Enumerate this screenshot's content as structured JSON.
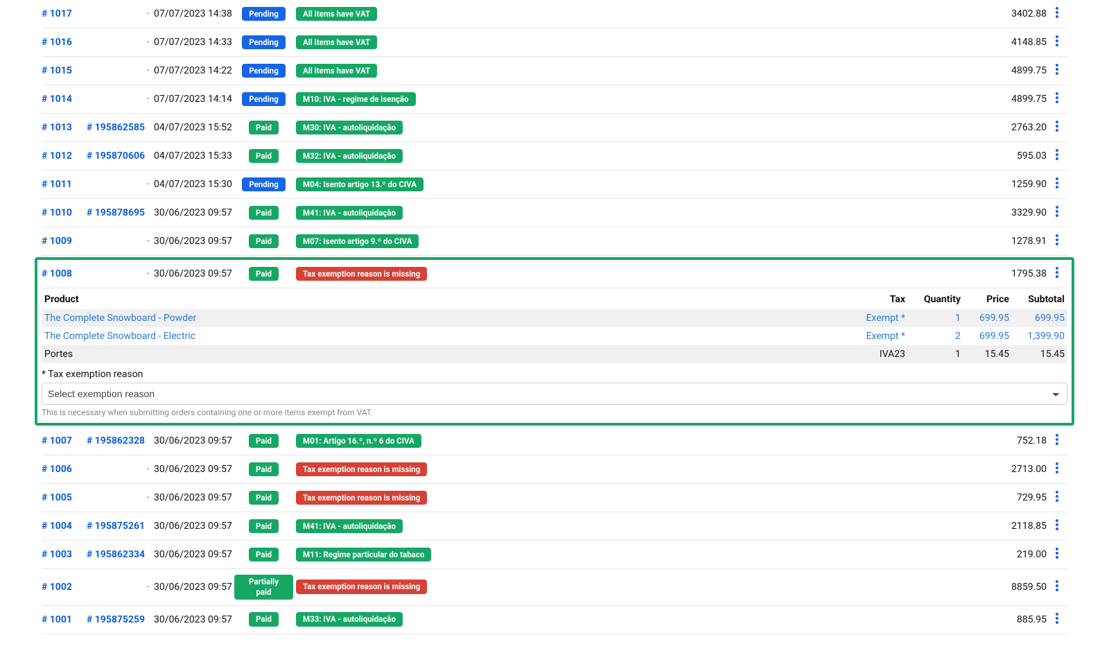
{
  "rows": [
    {
      "id": "# 1017",
      "ref": "",
      "date": "07/07/2023 14:38",
      "status": "Pending",
      "status_cls": "b-pending",
      "tag": "All items have VAT",
      "tag_cls": "b-green",
      "amount": "3402.88"
    },
    {
      "id": "# 1016",
      "ref": "",
      "date": "07/07/2023 14:33",
      "status": "Pending",
      "status_cls": "b-pending",
      "tag": "All items have VAT",
      "tag_cls": "b-green",
      "amount": "4148.85"
    },
    {
      "id": "# 1015",
      "ref": "",
      "date": "07/07/2023 14:22",
      "status": "Pending",
      "status_cls": "b-pending",
      "tag": "All items have VAT",
      "tag_cls": "b-green",
      "amount": "4899.75"
    },
    {
      "id": "# 1014",
      "ref": "",
      "date": "07/07/2023 14:14",
      "status": "Pending",
      "status_cls": "b-pending",
      "tag": "M10: IVA - regime de isenção",
      "tag_cls": "b-green",
      "amount": "4899.75"
    },
    {
      "id": "# 1013",
      "ref": "# 195862585",
      "date": "04/07/2023 15:52",
      "status": "Paid",
      "status_cls": "b-paid",
      "tag": "M30: IVA - autoliquidação",
      "tag_cls": "b-green",
      "amount": "2763.20"
    },
    {
      "id": "# 1012",
      "ref": "# 195870606",
      "date": "04/07/2023 15:33",
      "status": "Paid",
      "status_cls": "b-paid",
      "tag": "M32: IVA - autoliquidação",
      "tag_cls": "b-green",
      "amount": "595.03"
    },
    {
      "id": "# 1011",
      "ref": "",
      "date": "04/07/2023 15:30",
      "status": "Pending",
      "status_cls": "b-pending",
      "tag": "M04: Isento artigo 13.º do CIVA",
      "tag_cls": "b-green",
      "amount": "1259.90"
    },
    {
      "id": "# 1010",
      "ref": "# 195878695",
      "date": "30/06/2023 09:57",
      "status": "Paid",
      "status_cls": "b-paid",
      "tag": "M41: IVA - autoliquidação",
      "tag_cls": "b-green",
      "amount": "3329.90"
    },
    {
      "id": "# 1009",
      "ref": "",
      "date": "30/06/2023 09:57",
      "status": "Paid",
      "status_cls": "b-paid",
      "tag": "M07: Isento artigo 9.º do CIVA",
      "tag_cls": "b-green",
      "amount": "1278.91"
    }
  ],
  "highlight_row": {
    "id": "# 1008",
    "ref": "",
    "date": "30/06/2023 09:57",
    "status": "Paid",
    "status_cls": "b-paid",
    "tag": "Tax exemption reason is missing",
    "tag_cls": "b-red",
    "amount": "1795.38"
  },
  "detail": {
    "headers": {
      "product": "Product",
      "tax": "Tax",
      "qty": "Quantity",
      "price": "Price",
      "subtotal": "Subtotal"
    },
    "items": [
      {
        "product": "The Complete Snowboard - Powder",
        "tax": "Exempt *",
        "qty": "1",
        "price": "699.95",
        "subtotal": "699.95",
        "link": true
      },
      {
        "product": "The Complete Snowboard - Electric",
        "tax": "Exempt *",
        "qty": "2",
        "price": "699.95",
        "subtotal": "1,399.90",
        "link": true
      },
      {
        "product": "Portes",
        "tax": "IVA23",
        "qty": "1",
        "price": "15.45",
        "subtotal": "15.45",
        "link": false
      }
    ],
    "exempt_label": "* Tax exemption reason",
    "exempt_placeholder": "Select exemption reason",
    "help": "This is necessary when submitting orders containing one or more items exempt from VAT."
  },
  "rows_after": [
    {
      "id": "# 1007",
      "ref": "# 195862328",
      "date": "30/06/2023 09:57",
      "status": "Paid",
      "status_cls": "b-paid",
      "tag": "M01: Artigo 16.º, n.º 6 do CIVA",
      "tag_cls": "b-green",
      "amount": "752.18"
    },
    {
      "id": "# 1006",
      "ref": "",
      "date": "30/06/2023 09:57",
      "status": "Paid",
      "status_cls": "b-paid",
      "tag": "Tax exemption reason is missing",
      "tag_cls": "b-red",
      "amount": "2713.00"
    },
    {
      "id": "# 1005",
      "ref": "",
      "date": "30/06/2023 09:57",
      "status": "Paid",
      "status_cls": "b-paid",
      "tag": "Tax exemption reason is missing",
      "tag_cls": "b-red",
      "amount": "729.95"
    },
    {
      "id": "# 1004",
      "ref": "# 195875261",
      "date": "30/06/2023 09:57",
      "status": "Paid",
      "status_cls": "b-paid",
      "tag": "M41: IVA - autoliquidação",
      "tag_cls": "b-green",
      "amount": "2118.85"
    },
    {
      "id": "# 1003",
      "ref": "# 195862334",
      "date": "30/06/2023 09:57",
      "status": "Paid",
      "status_cls": "b-paid",
      "tag": "M11: Regime particular do tabaco",
      "tag_cls": "b-green",
      "amount": "219.00"
    },
    {
      "id": "# 1002",
      "ref": "",
      "date": "30/06/2023 09:57",
      "status": "Partially paid",
      "status_cls": "b-partial",
      "tag": "Tax exemption reason is missing",
      "tag_cls": "b-red",
      "amount": "8859.50"
    },
    {
      "id": "# 1001",
      "ref": "# 195875259",
      "date": "30/06/2023 09:57",
      "status": "Paid",
      "status_cls": "b-paid",
      "tag": "M33: IVA - autoliquidação",
      "tag_cls": "b-green",
      "amount": "885.95"
    }
  ]
}
